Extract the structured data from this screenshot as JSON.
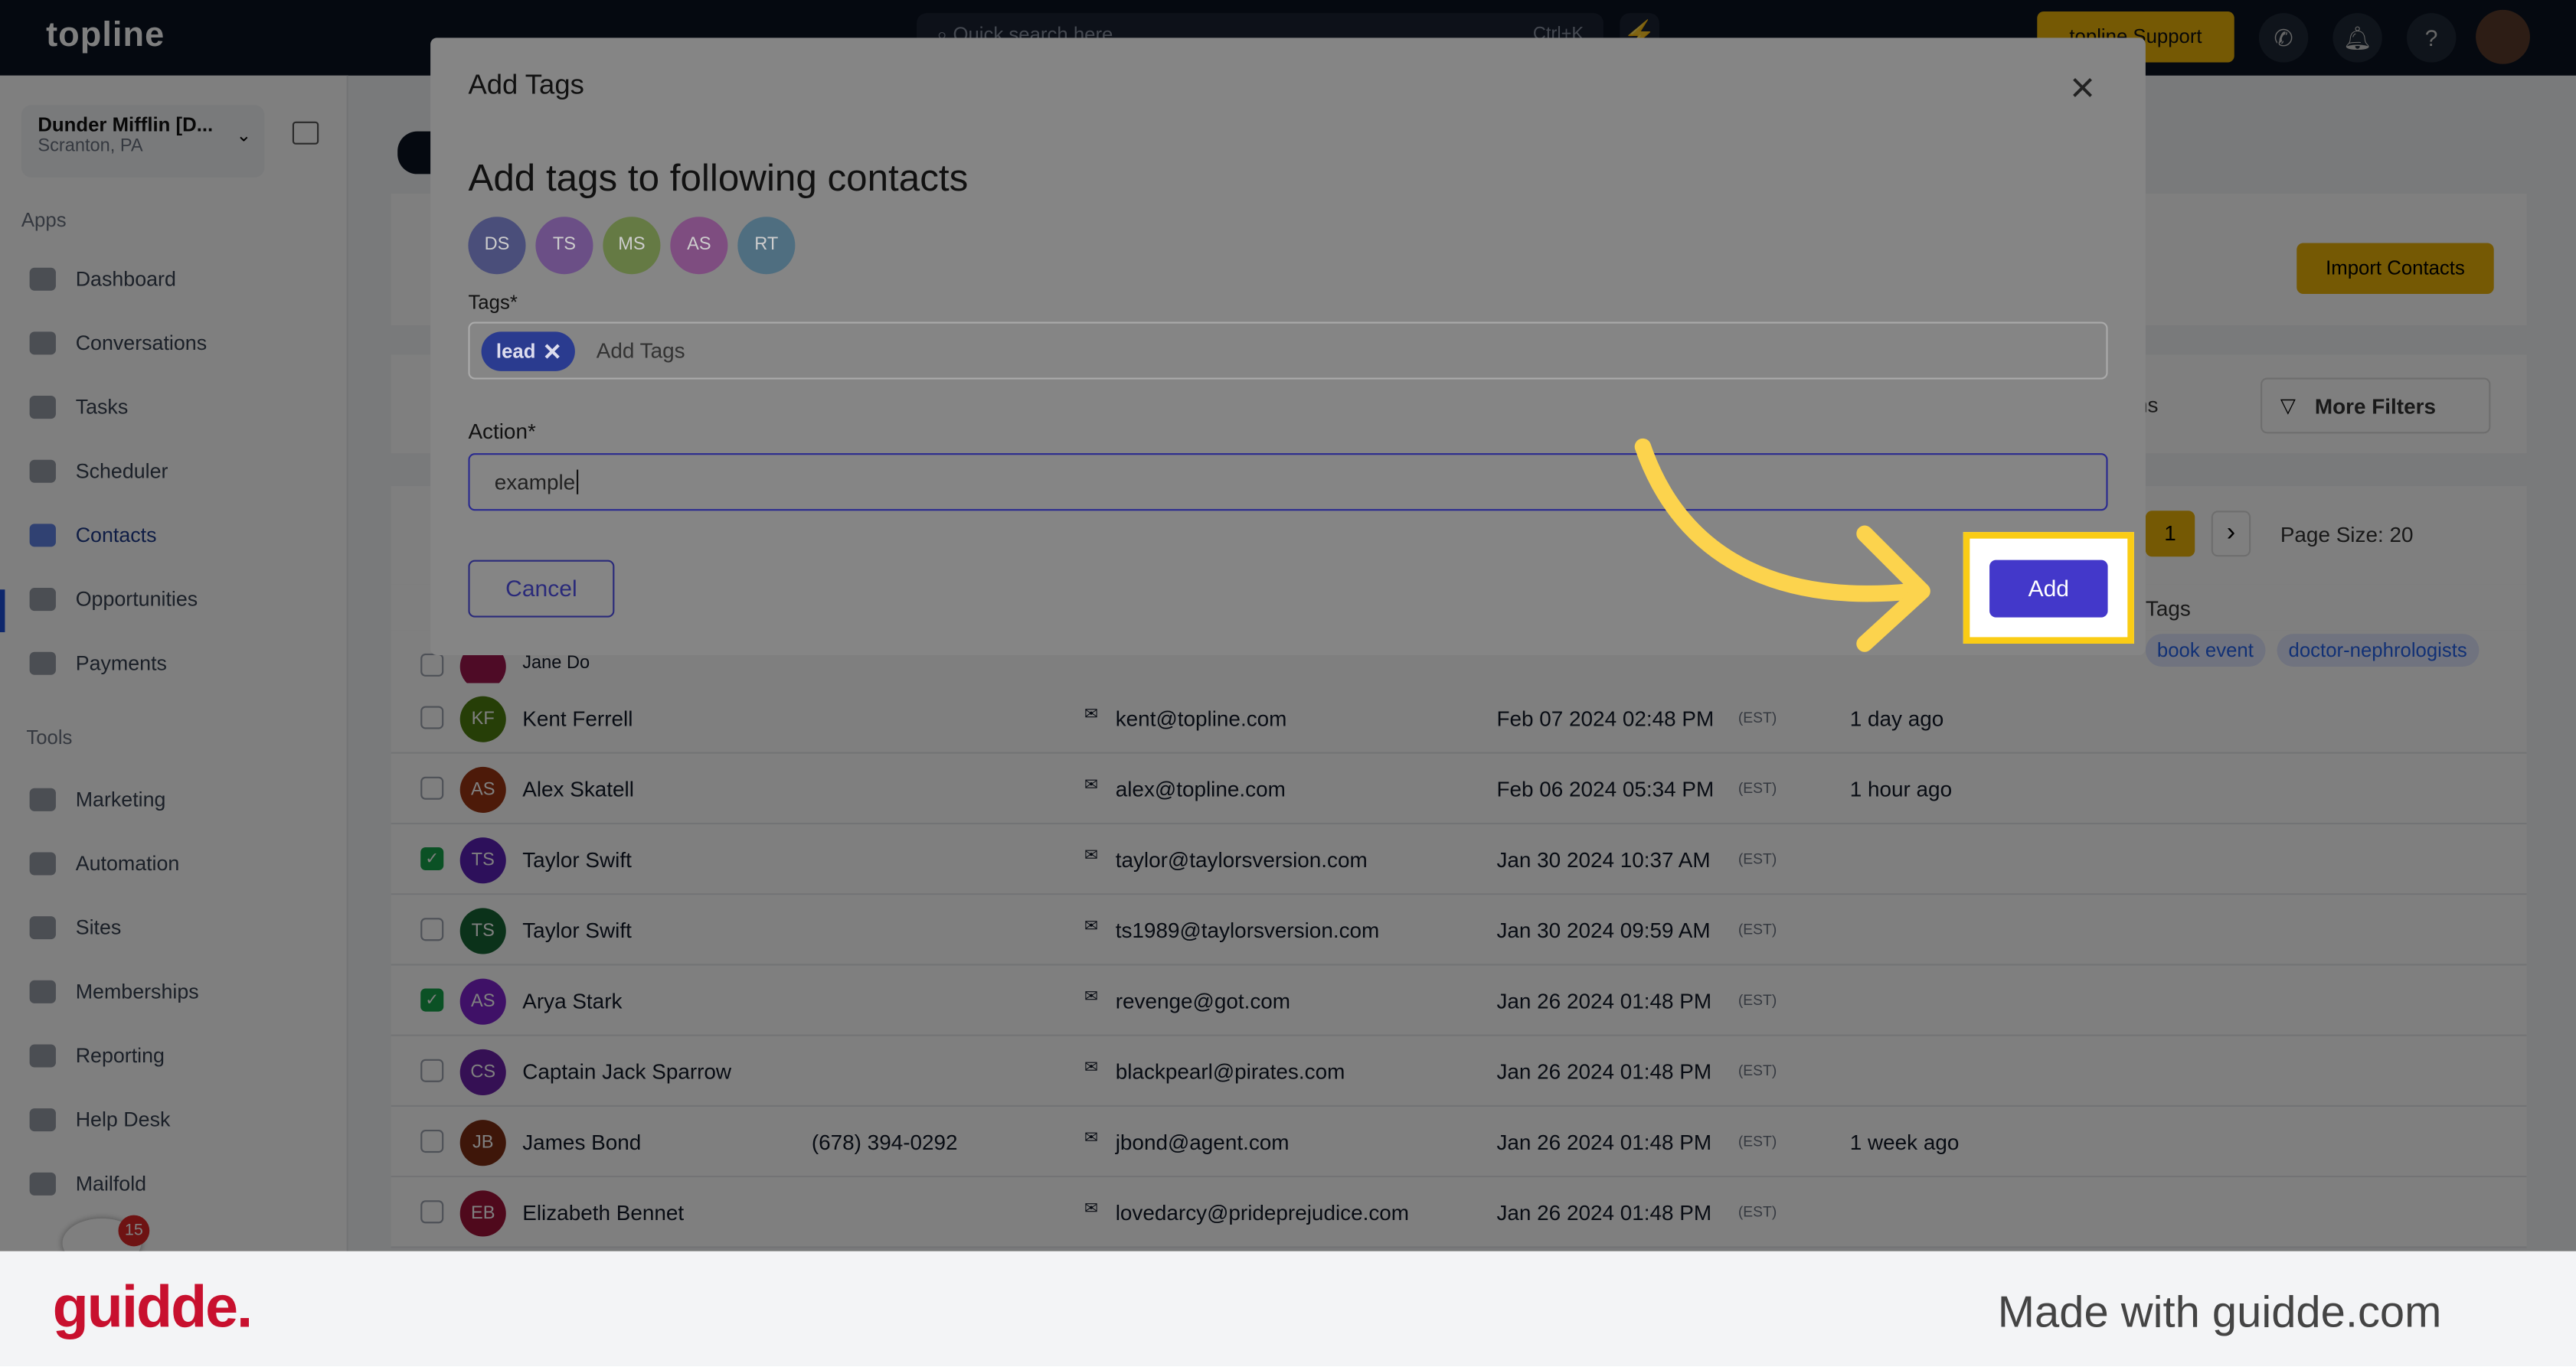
{
  "topbar": {
    "logo": "topline",
    "search_placeholder": "Quick search here",
    "search_shortcut": "Ctrl+K",
    "support_label": "topline Support"
  },
  "sidebar": {
    "location_name": "Dunder Mifflin [D...",
    "location_city": "Scranton, PA",
    "apps_heading": "Apps",
    "tools_heading": "Tools",
    "apps": [
      "Dashboard",
      "Conversations",
      "Tasks",
      "Scheduler",
      "Contacts",
      "Opportunities",
      "Payments"
    ],
    "tools": [
      "Marketing",
      "Automation",
      "Sites",
      "Memberships",
      "Reporting",
      "Help Desk",
      "Mailfold"
    ],
    "active": "Contacts",
    "notification_count": "15"
  },
  "page": {
    "import_label": "Import Contacts",
    "columns_label": "ns",
    "more_filters_label": "More Filters",
    "page_number": "1",
    "page_size_label": "Page Size: 20",
    "tags_header": "Tags"
  },
  "contacts": [
    {
      "initials": "",
      "name": "Jane Do",
      "phone": "",
      "email": "",
      "date": "",
      "tz": "",
      "activity": "",
      "checked": false,
      "color": "#9d174d",
      "tags": [
        "book event",
        "doctor-nephrologists"
      ]
    },
    {
      "initials": "KF",
      "name": "Kent Ferrell",
      "phone": "",
      "email": "kent@topline.com",
      "date": "Feb 07 2024 02:48 PM",
      "tz": "(EST)",
      "activity": "1 day ago",
      "checked": false,
      "color": "#4d7c0f"
    },
    {
      "initials": "AS",
      "name": "Alex Skatell",
      "phone": "",
      "email": "alex@topline.com",
      "date": "Feb 06 2024 05:34 PM",
      "tz": "(EST)",
      "activity": "1 hour ago",
      "checked": false,
      "color": "#9a3412"
    },
    {
      "initials": "TS",
      "name": "Taylor Swift",
      "phone": "",
      "email": "taylor@taylorsversion.com",
      "date": "Jan 30 2024 10:37 AM",
      "tz": "(EST)",
      "activity": "",
      "checked": true,
      "color": "#5b21b6"
    },
    {
      "initials": "TS",
      "name": "Taylor Swift",
      "phone": "",
      "email": "ts1989@taylorsversion.com",
      "date": "Jan 30 2024 09:59 AM",
      "tz": "(EST)",
      "activity": "",
      "checked": false,
      "color": "#166534"
    },
    {
      "initials": "AS",
      "name": "Arya Stark",
      "phone": "",
      "email": "revenge@got.com",
      "date": "Jan 26 2024 01:48 PM",
      "tz": "(EST)",
      "activity": "",
      "checked": true,
      "color": "#7e22ce"
    },
    {
      "initials": "CS",
      "name": "Captain Jack Sparrow",
      "phone": "",
      "email": "blackpearl@pirates.com",
      "date": "Jan 26 2024 01:48 PM",
      "tz": "(EST)",
      "activity": "",
      "checked": false,
      "color": "#6b21a8"
    },
    {
      "initials": "JB",
      "name": "James Bond",
      "phone": "(678) 394-0292",
      "email": "jbond@agent.com",
      "date": "Jan 26 2024 01:48 PM",
      "tz": "(EST)",
      "activity": "1 week ago",
      "checked": false,
      "color": "#7c2d12"
    },
    {
      "initials": "EB",
      "name": "Elizabeth Bennet",
      "phone": "",
      "email": "lovedarcy@prideprejudice.com",
      "date": "Jan 26 2024 01:48 PM",
      "tz": "(EST)",
      "activity": "",
      "checked": false,
      "color": "#9f1239"
    }
  ],
  "modal": {
    "title": "Add Tags",
    "subtitle": "Add tags to following contacts",
    "selected": [
      {
        "initials": "DS",
        "color": "#4a4e7a"
      },
      {
        "initials": "TS",
        "color": "#6b4f86"
      },
      {
        "initials": "MS",
        "color": "#657a44"
      },
      {
        "initials": "AS",
        "color": "#7e4d80"
      },
      {
        "initials": "RT",
        "color": "#4f6e80"
      }
    ],
    "tags_label": "Tags*",
    "tag_chip": "lead",
    "tags_placeholder": "Add Tags",
    "action_label": "Action*",
    "action_value": "example",
    "cancel_label": "Cancel",
    "add_label": "Add"
  },
  "colors": {
    "primary": "#4338ca",
    "highlight": "#facc15"
  },
  "footer": {
    "brand": "guidde.",
    "made_with": "Made with guidde.com"
  }
}
